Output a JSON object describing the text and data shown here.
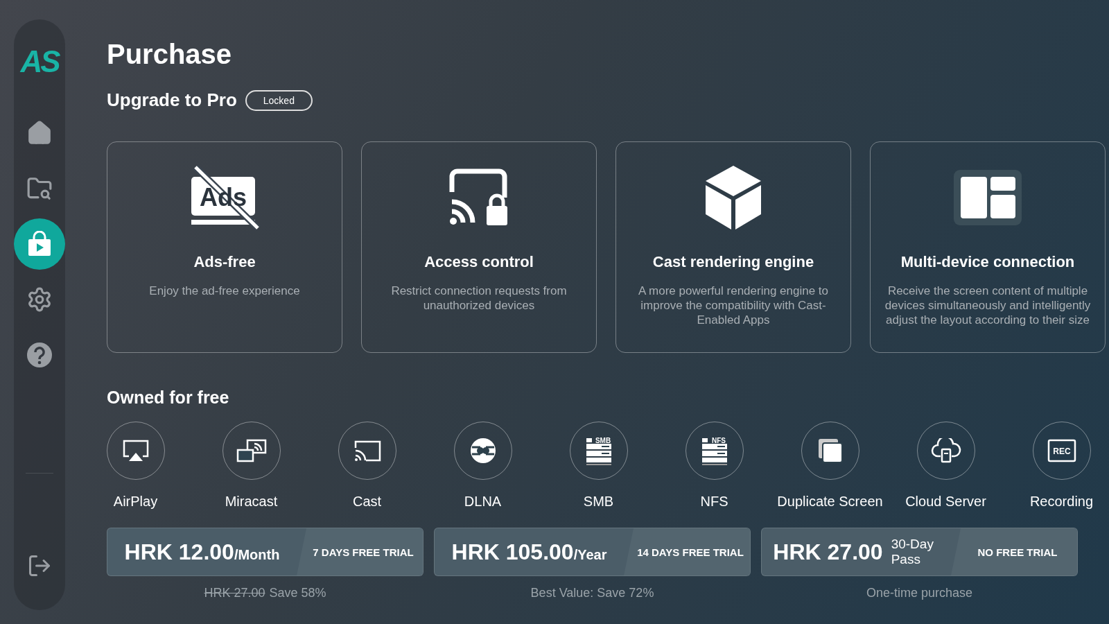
{
  "sidebar": {
    "logo": "AS",
    "items": [
      {
        "kind": "home",
        "selected": false
      },
      {
        "kind": "files",
        "selected": false
      },
      {
        "kind": "store",
        "selected": true
      },
      {
        "kind": "settings",
        "selected": false
      },
      {
        "kind": "help",
        "selected": false
      }
    ],
    "bottom_item": {
      "kind": "exit"
    }
  },
  "title": "Purchase",
  "upgrade": {
    "heading": "Upgrade to Pro",
    "badge": "Locked"
  },
  "features": [
    {
      "kind": "ads",
      "icon_label": "Ads",
      "title": "Ads-free",
      "description": "Enjoy the ad-free experience"
    },
    {
      "kind": "lock",
      "title": "Access control",
      "description": "Restrict connection requests from unauthorized devices"
    },
    {
      "kind": "cube",
      "title": "Cast rendering engine",
      "description": "A more powerful rendering engine to improve the compatibility with Cast-Enabled Apps"
    },
    {
      "kind": "layout",
      "title": "Multi-device connection",
      "description": "Receive the screen content of multiple devices simultaneously and intelligently adjust the layout according to their size"
    }
  ],
  "owned": {
    "heading": "Owned for free",
    "items": [
      {
        "kind": "airplay",
        "label": "AirPlay"
      },
      {
        "kind": "miracast",
        "label": "Miracast"
      },
      {
        "kind": "cast",
        "label": "Cast"
      },
      {
        "kind": "dlna",
        "label": "DLNA"
      },
      {
        "kind": "server",
        "icon_label": "SMB",
        "label": "SMB"
      },
      {
        "kind": "server",
        "icon_label": "NFS",
        "label": "NFS"
      },
      {
        "kind": "duplicate",
        "label": "Duplicate Screen"
      },
      {
        "kind": "cloud",
        "label": "Cloud Server"
      },
      {
        "kind": "rec",
        "icon_label": "REC",
        "label": "Recording"
      }
    ]
  },
  "plans": [
    {
      "kind": "recurring",
      "price": "HRK 12.00",
      "period": "/Month",
      "trial": "7 DAYS FREE TRIAL",
      "old_price": "HRK 27.00",
      "note": "Save 58%"
    },
    {
      "kind": "recurring",
      "price": "HRK 105.00",
      "period": "/Year",
      "trial": "14 DAYS FREE TRIAL",
      "note": "Best Value: Save 72%"
    },
    {
      "kind": "pass",
      "price": "HRK 27.00",
      "period": "30-Day Pass",
      "trial": "NO FREE TRIAL",
      "note": "One-time purchase"
    }
  ]
}
